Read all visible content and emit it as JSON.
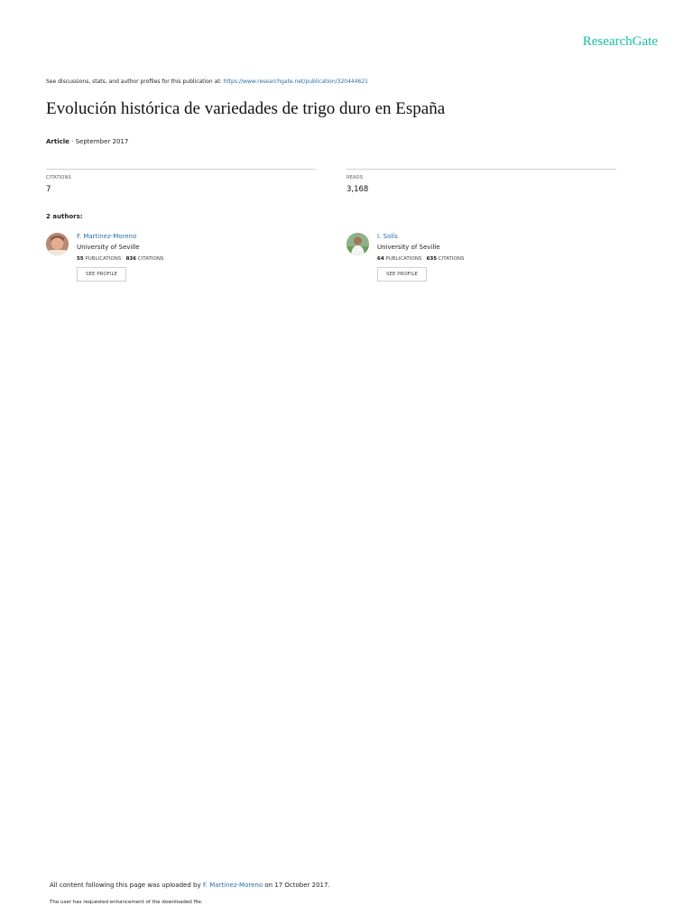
{
  "header": {
    "logo": "ResearchGate",
    "discuss_prefix": "See discussions, stats, and author profiles for this publication at: ",
    "discuss_link": "https://www.researchgate.net/publication/320444621"
  },
  "publication": {
    "title": "Evolución histórica de variedades de trigo duro en España",
    "type": "Article",
    "date": " · September 2017"
  },
  "stats": {
    "citations_label": "CITATIONS",
    "citations_value": "7",
    "reads_label": "READS",
    "reads_value": "3,168"
  },
  "authors": {
    "heading": "2 authors:",
    "list": [
      {
        "name": "F. Martínez-Moreno",
        "institution": "University of Seville",
        "publications": "55",
        "publications_label": "PUBLICATIONS",
        "citations": "836",
        "citations_label": "CITATIONS",
        "button": "SEE PROFILE"
      },
      {
        "name": "I. Solís",
        "institution": "University of Seville",
        "publications": "64",
        "publications_label": "PUBLICATIONS",
        "citations": "635",
        "citations_label": "CITATIONS",
        "button": "SEE PROFILE"
      }
    ]
  },
  "footer": {
    "upload_prefix": "All content following this page was uploaded by ",
    "uploader": "F. Martínez-Moreno",
    "upload_suffix": " on 17 October 2017.",
    "enhancement_note": "The user has requested enhancement of the downloaded file."
  },
  "colors": {
    "brand": "#16bfa6",
    "link": "#2b6ea6"
  }
}
